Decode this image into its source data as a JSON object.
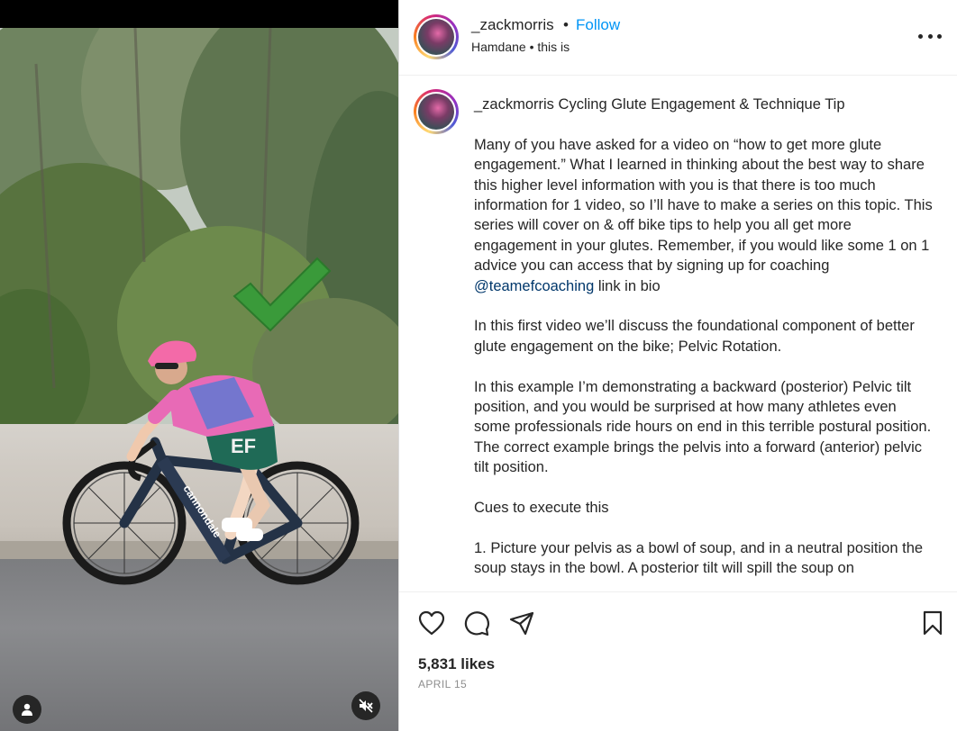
{
  "header": {
    "username": "_zackmorris",
    "separator": "•",
    "follow_label": "Follow",
    "subtitle": "Hamdane • this is",
    "more_icon": "more-horizontal-icon"
  },
  "caption": {
    "username": "_zackmorris",
    "title": "Cycling Glute Engagement & Technique Tip",
    "p1_before": "Many of you have asked for a video on “how to get more glute engagement.” What I learned in thinking about the best way to share this higher level information with you is that there is too much information for 1 video, so I’ll have to make a series on this topic. This series will cover on & off bike tips to help you all get more engagement in your glutes. Remember, if you would like some 1 on 1 advice you can access that by signing up for coaching ",
    "mention": "@teamefcoaching",
    "p1_after": " link in bio",
    "p2": "In this first video we’ll discuss the foundational component of better glute engagement on the bike; Pelvic Rotation.",
    "p3": "In this example I’m demonstrating a backward (posterior) Pelvic tilt position, and you would be surprised at how many athletes even some professionals ride hours on end in this terrible postural position. The correct example brings the pelvis into a forward (anterior) pelvic tilt position.",
    "p4": "Cues to execute this",
    "p5": "1. Picture your pelvis as a bowl of soup, and in a neutral position the soup stays in the bowl. A posterior tilt will spill the soup on"
  },
  "actions": {
    "like_icon": "heart-icon",
    "comment_icon": "comment-icon",
    "share_icon": "send-icon",
    "save_icon": "bookmark-icon",
    "likes": "5,831 likes",
    "date": "APRIL 15"
  },
  "media": {
    "jersey_text": "EF",
    "bike_text": "cannondale",
    "overlay_icon": "checkmark-icon",
    "user_icon": "user-icon",
    "mute_icon": "muted-speaker-icon"
  },
  "colors": {
    "follow": "#0095f6",
    "mention": "#00376b",
    "text": "#262626",
    "muted": "#8e8e8e",
    "checkmark": "#3a9a3a"
  }
}
